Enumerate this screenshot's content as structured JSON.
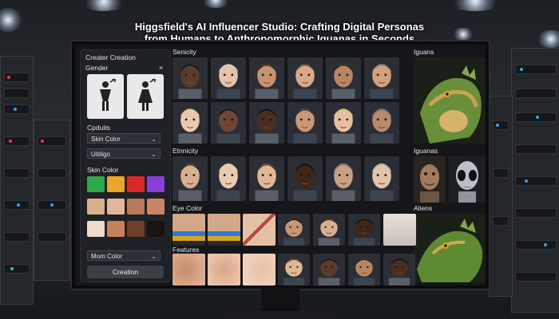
{
  "headline": {
    "line1": "Higgsfield's AI Influencer Studio: Crafting Digital Personas",
    "line2": "from Humans to Anthropomorphic Iguanas in Seconds"
  },
  "panel": {
    "title": "Creater Creation",
    "gender_label": "Gender",
    "close_glyph": "×",
    "outputs_label": "Cpduits",
    "skin_select": "Skin Color",
    "vitiligo_select": "Uitiligo",
    "skin_color_label": "Skin Color",
    "mom_color_select": "Mom Color",
    "creation_button": "Creation",
    "chevron": "⌄"
  },
  "sections": {
    "senicity": "Senicity",
    "etnicity": "Etnnicity",
    "eye_color": "Eye Color",
    "features": "Features",
    "iguans": "Iguans",
    "iguanas": "Iguanas",
    "aliens": "Aliens"
  },
  "swatches": [
    "#2ea84a",
    "#e8a62a",
    "#d92a2a",
    "#8a3fd6",
    "#d8b08c",
    "#e0b898",
    "#b77a5a",
    "#c98566",
    "#ecdcc8",
    "#c8805a",
    "#6e3e26",
    "#1a1410"
  ],
  "colors": {
    "screen_bg": "#14161a",
    "panel_bg": "#1e2126",
    "text": "#e6e6e6",
    "button_bg": "#3b4047"
  },
  "icons": {
    "male": "male-symbol-icon",
    "female": "female-symbol-icon"
  }
}
